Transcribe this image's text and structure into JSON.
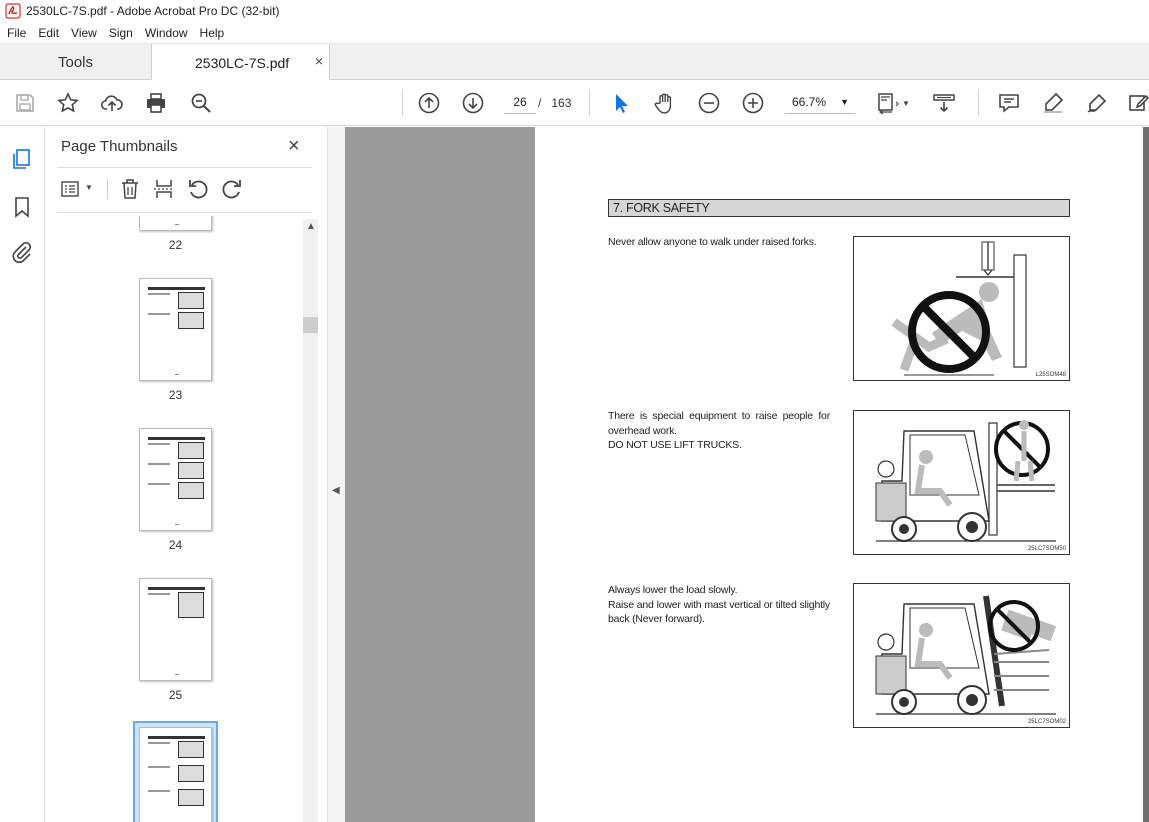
{
  "window": {
    "title": "2530LC-7S.pdf - Adobe Acrobat Pro DC (32-bit)"
  },
  "menu": [
    "File",
    "Edit",
    "View",
    "Sign",
    "Window",
    "Help"
  ],
  "tabs": {
    "tools": "Tools",
    "document": "2530LC-7S.pdf",
    "close": "×"
  },
  "toolbar": {
    "current_page": "26",
    "page_separator": "/",
    "total_pages": "163",
    "zoom": "66.7%"
  },
  "thumbnails": {
    "title": "Page Thumbnails",
    "close": "×",
    "pages": [
      "22",
      "23",
      "24",
      "25"
    ]
  },
  "document": {
    "section_title": "7. FORK SAFETY",
    "para1": "Never allow anyone to walk under raised forks.",
    "para2a": "There is special equipment to raise people for overhead work.",
    "para2b": "DO NOT USE LIFT TRUCKS.",
    "para3a": "Always lower the load slowly.",
    "para3b": "Raise and lower with mast vertical or tilted slightly back (Never forward).",
    "fig1_code": "L25SOM48",
    "fig2_code": "25LC7SOM50",
    "fig3_code": "25LC7SOM02"
  },
  "colors": {
    "selection_border": "#6aa8e8",
    "selection_fill": "#cfe4fb",
    "doc_background": "#9b9b9b",
    "accent_blue": "#1473e6"
  }
}
